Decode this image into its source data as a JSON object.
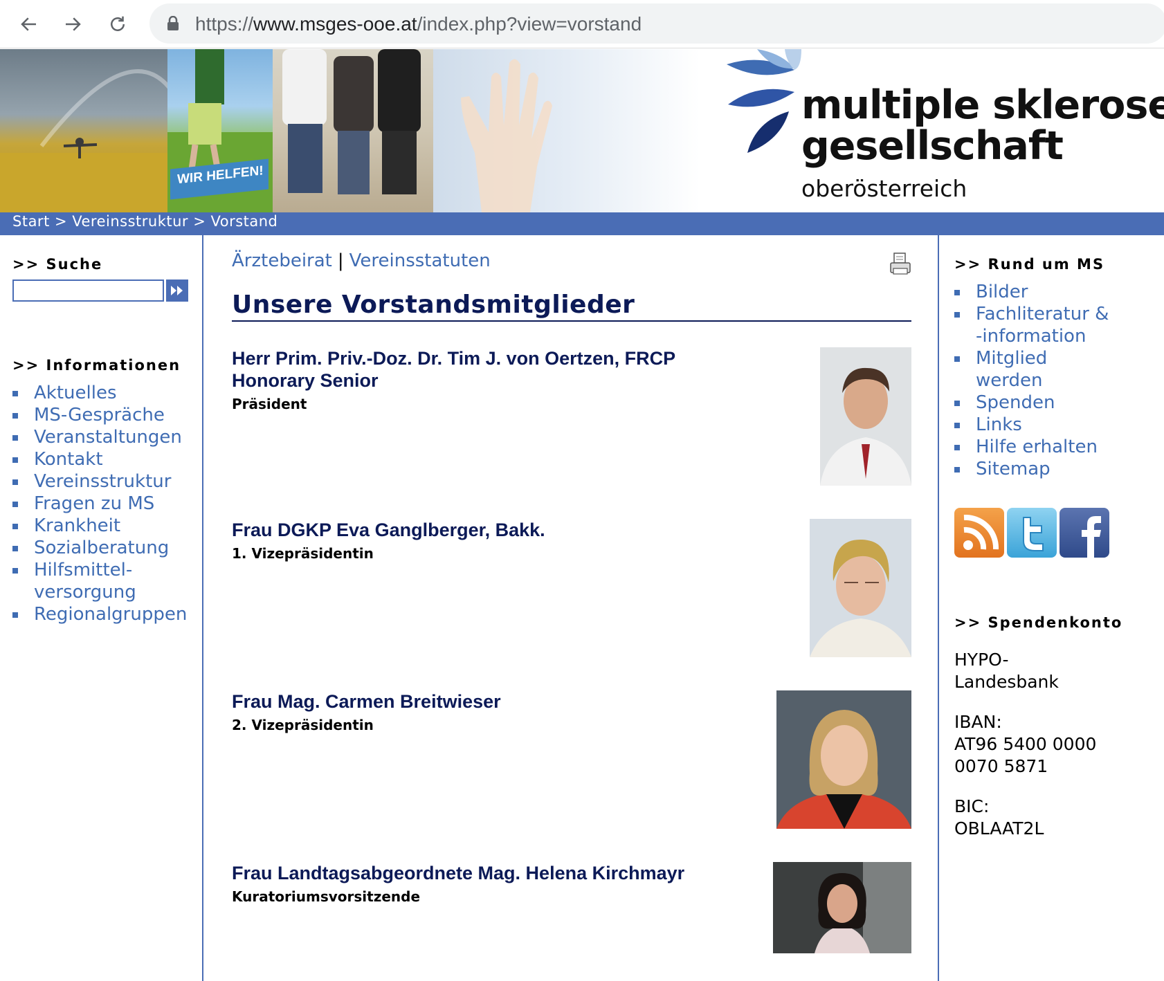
{
  "browser": {
    "url_scheme": "https://",
    "url_host": "www.msges-ooe.at",
    "url_path": "/index.php?view=vorstand"
  },
  "banner": {
    "tag_text": "WIR HELFEN!",
    "logo_line1": "multiple sklerose",
    "logo_line2": "gesellschaft",
    "logo_line3": "oberösterreich"
  },
  "breadcrumb": "Start > Vereinsstruktur > Vorstand",
  "left": {
    "search_title": ">> Suche",
    "info_title": ">> Informationen",
    "items": [
      "Aktuelles",
      "MS-Gespräche",
      "Veranstaltungen",
      "Kontakt",
      "Vereinsstruktur",
      "Fragen zu MS",
      "Krankheit",
      "Sozialberatung",
      "Hilfsmittel-\nversorgung",
      "Regionalgruppen"
    ]
  },
  "main": {
    "link1": "Ärztebeirat",
    "sep": "|",
    "link2": "Vereinsstatuten",
    "title": "Unsere Vorstandsmitglieder",
    "members": [
      {
        "name": "Herr Prim. Priv.-Doz. Dr. Tim J. von Oertzen, FRCP Honorary Senior",
        "role": "Präsident"
      },
      {
        "name": "Frau DGKP Eva Ganglberger, Bakk.",
        "role": "1. Vizepräsidentin"
      },
      {
        "name": "Frau Mag. Carmen Breitwieser",
        "role": "2. Vizepräsidentin"
      },
      {
        "name": "Frau Landtagsabgeordnete Mag. Helena Kirchmayr",
        "role": "Kuratoriumsvorsitzende"
      }
    ]
  },
  "right": {
    "rund_title": ">> Rund um MS",
    "items": [
      "Bilder",
      "Fachliteratur &\n-information",
      "Mitglied\nwerden",
      "Spenden",
      "Links",
      "Hilfe erhalten",
      "Sitemap"
    ],
    "konto_title": ">> Spendenkonto",
    "bank": "HYPO-\nLandesbank",
    "iban_label": "IBAN:",
    "iban": "AT96 5400 0000\n0070 5871",
    "bic_label": "BIC:",
    "bic": "OBLAAT2L"
  },
  "colors": {
    "accent": "#4a6db5",
    "link": "#3f6cb3",
    "title": "#0c1a57"
  }
}
